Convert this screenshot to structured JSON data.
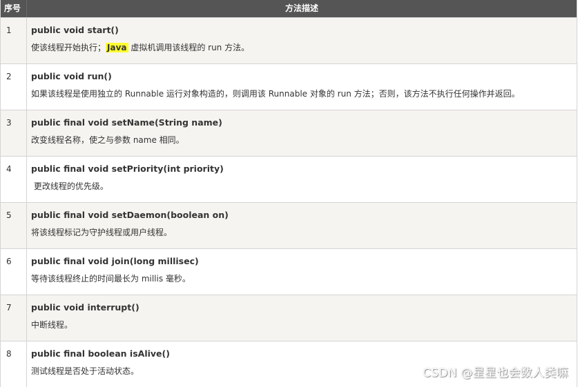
{
  "header": {
    "col_num": "序号",
    "col_desc": "方法描述"
  },
  "rows": [
    {
      "num": "1",
      "sig": "public void start()",
      "desc_pre": "使该线程开始执行；",
      "desc_highlight": "Java",
      "desc_post": " 虚拟机调用该线程的 run 方法。"
    },
    {
      "num": "2",
      "sig": "public void run()",
      "desc": "如果该线程是使用独立的 Runnable 运行对象构造的，则调用该 Runnable 对象的 run 方法；否则，该方法不执行任何操作并返回。"
    },
    {
      "num": "3",
      "sig": "public final void setName(String name)",
      "desc": "改变线程名称，使之与参数 name 相同。"
    },
    {
      "num": "4",
      "sig": "public final void setPriority(int priority)",
      "desc": " 更改线程的优先级。"
    },
    {
      "num": "5",
      "sig": "public final void setDaemon(boolean on)",
      "desc": "将该线程标记为守护线程或用户线程。"
    },
    {
      "num": "6",
      "sig": "public final void join(long millisec)",
      "desc": "等待该线程终止的时间最长为 millis 毫秒。"
    },
    {
      "num": "7",
      "sig": "public void interrupt()",
      "desc": "中断线程。"
    },
    {
      "num": "8",
      "sig": "public final boolean isAlive()",
      "desc": "测试线程是否处于活动状态。"
    }
  ],
  "watermark": "CSDN @星星也会数人类嘛",
  "colors": {
    "header_bg": "#555555",
    "row_alt_bg": "#f6f4f0",
    "highlight": "#ffff2e"
  }
}
